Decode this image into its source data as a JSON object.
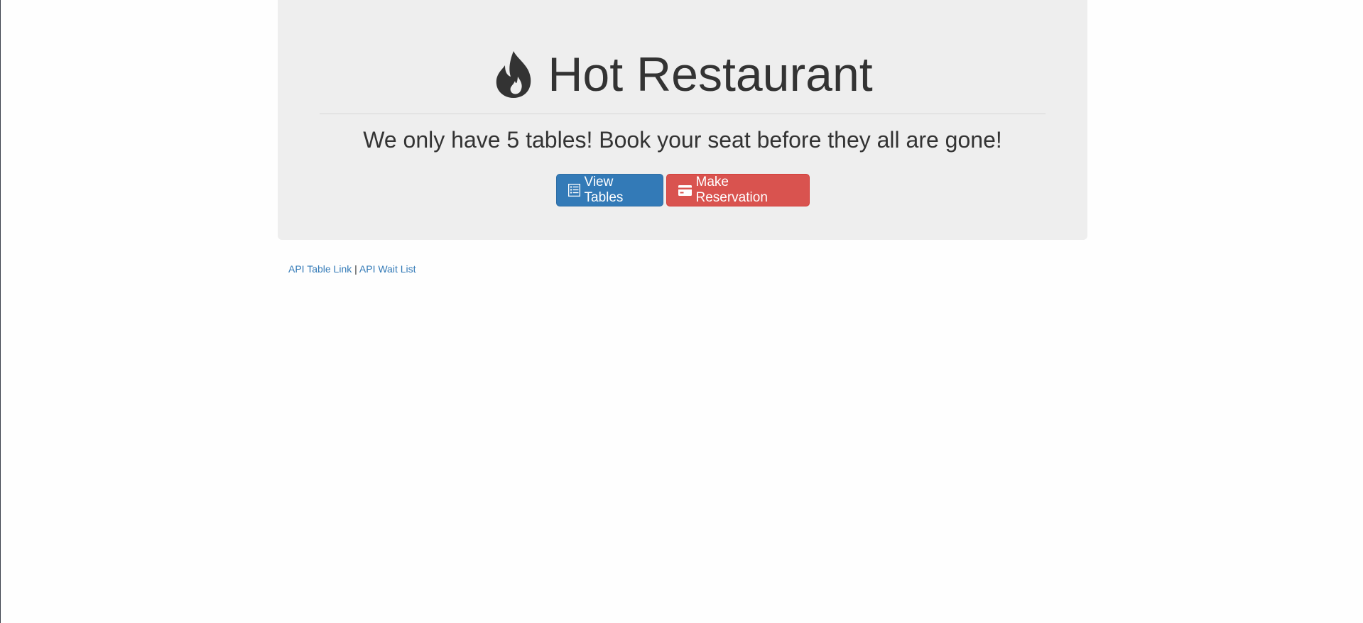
{
  "header": {
    "title": "Hot Restaurant",
    "icon": "fire-icon",
    "subtitle": "We only have 5 tables! Book your seat before they all are gone!"
  },
  "buttons": {
    "view_tables": {
      "label": "View Tables",
      "icon": "list-alt-icon",
      "color": "#337ab7"
    },
    "make_reservation": {
      "label": "Make Reservation",
      "icon": "credit-card-icon",
      "color": "#d9534f"
    }
  },
  "footer_links": {
    "api_table": "API Table Link",
    "separator": "|",
    "api_wait": "API Wait List",
    "link_color": "#337ab7"
  },
  "colors": {
    "jumbotron_bg": "#eeeeee",
    "text": "#333333"
  }
}
